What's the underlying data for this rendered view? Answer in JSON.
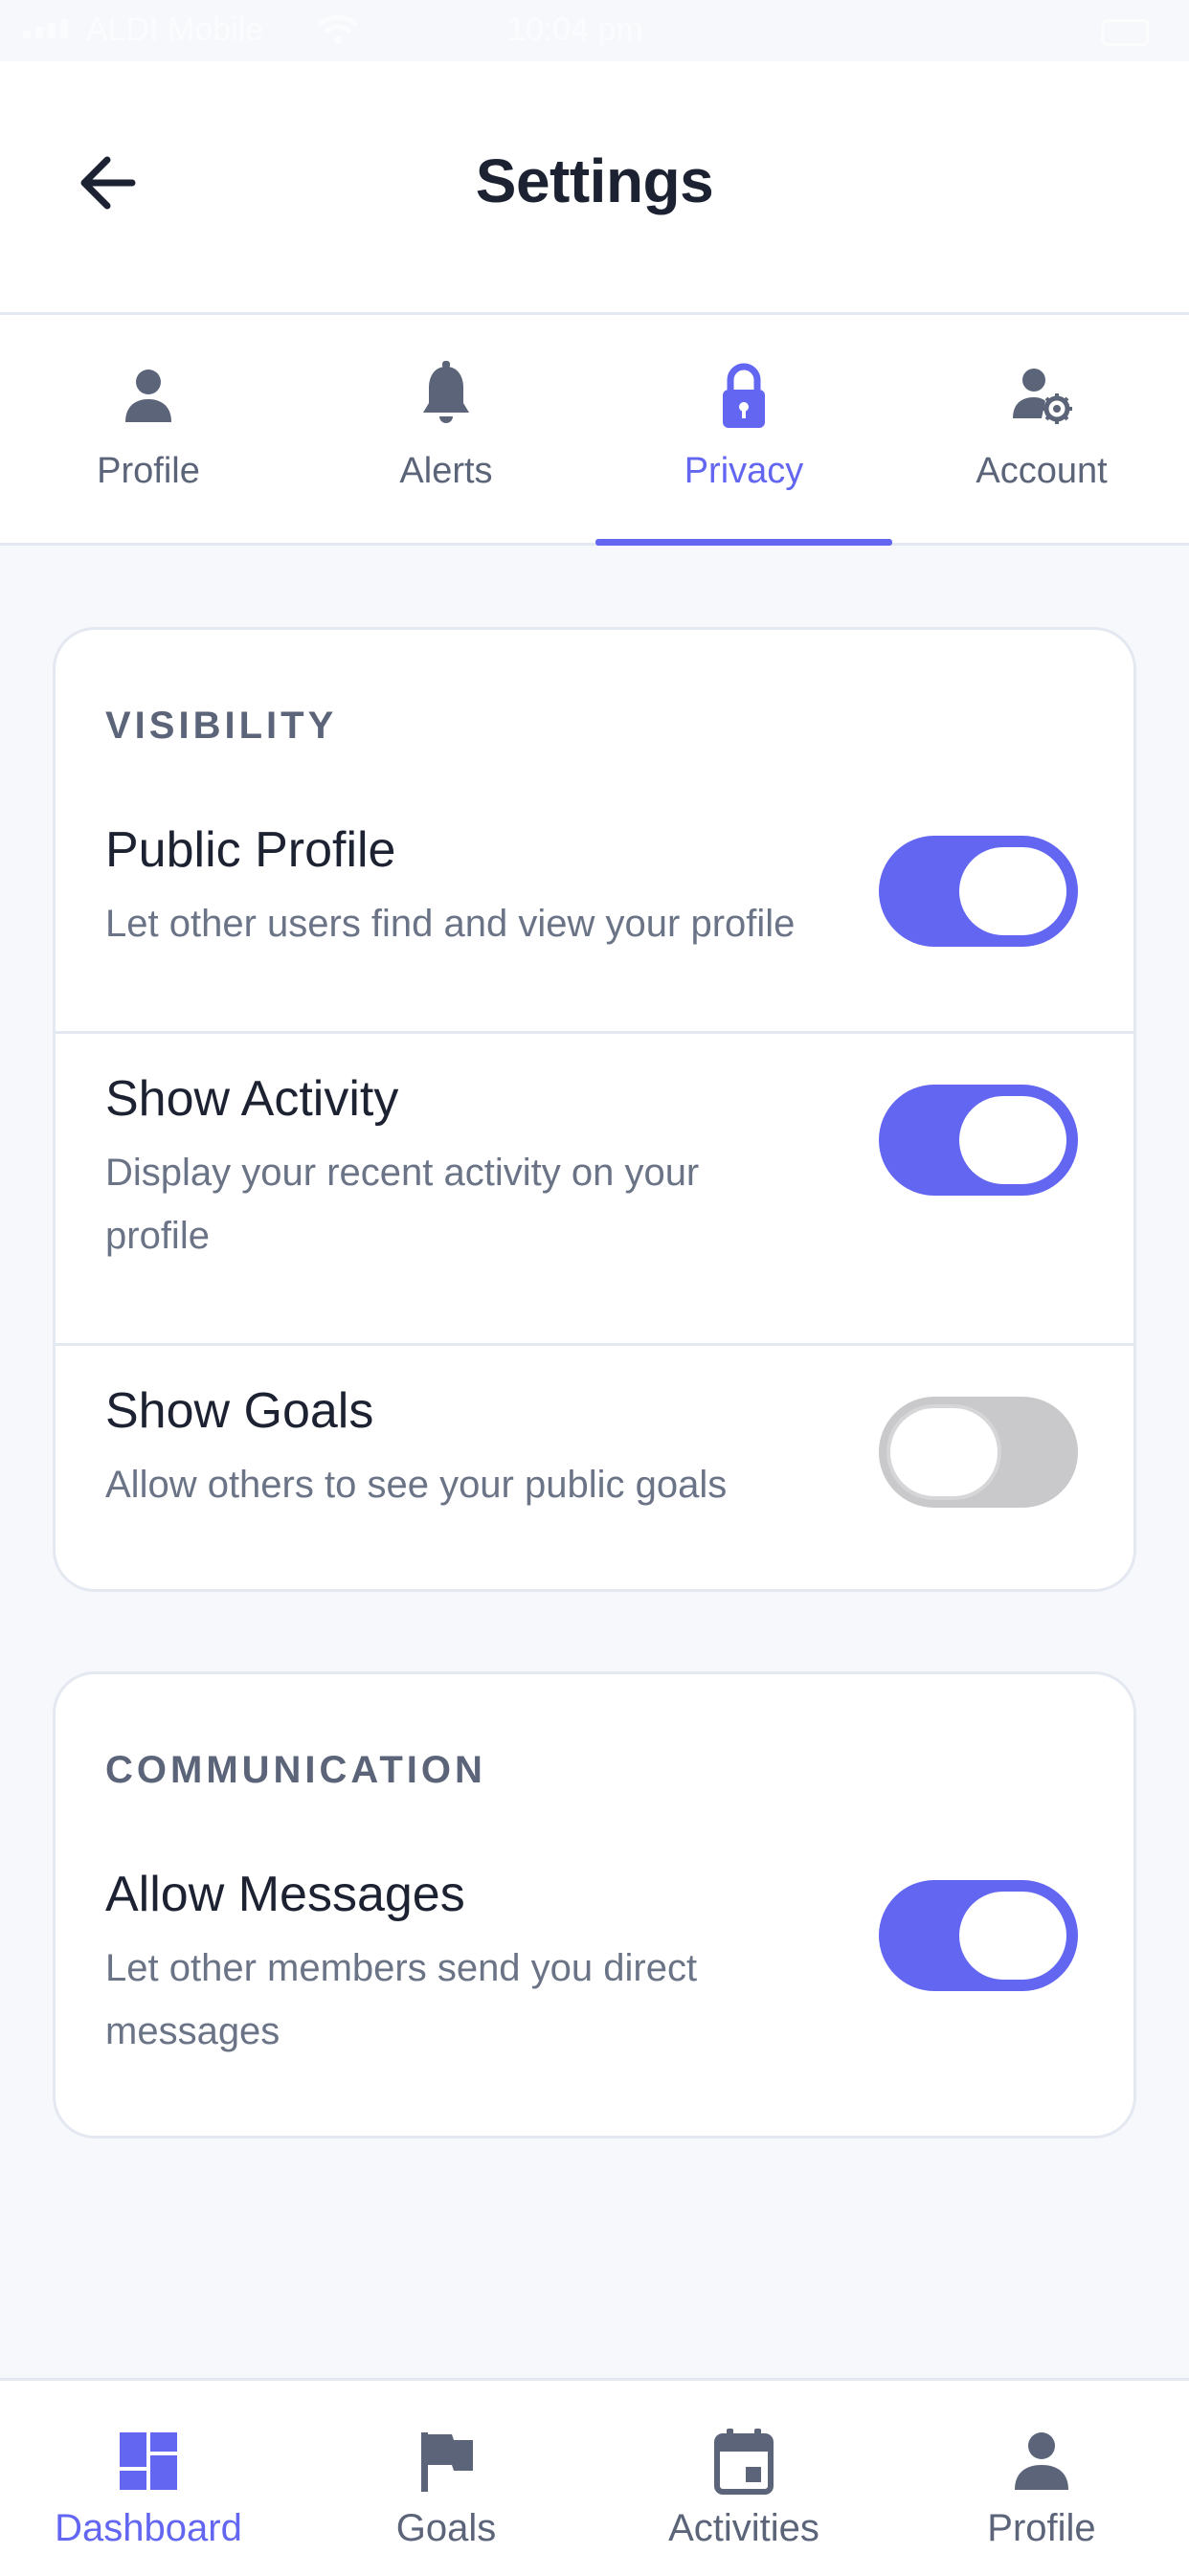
{
  "status_bar": {
    "carrier": "ALDI Mobile",
    "time": "10:04 pm"
  },
  "header": {
    "title": "Settings"
  },
  "tabs": [
    {
      "label": "Profile",
      "icon": "person-icon",
      "active": false
    },
    {
      "label": "Alerts",
      "icon": "bell-icon",
      "active": false
    },
    {
      "label": "Privacy",
      "icon": "lock-icon",
      "active": true
    },
    {
      "label": "Account",
      "icon": "user-gear-icon",
      "active": false
    }
  ],
  "visibility": {
    "title": "VISIBILITY",
    "items": [
      {
        "title": "Public Profile",
        "description": "Let other users find and view your profile",
        "enabled": true
      },
      {
        "title": "Show Activity",
        "description": "Display your recent activity on your profile",
        "enabled": true
      },
      {
        "title": "Show Goals",
        "description": "Allow others to see your public goals",
        "enabled": false
      }
    ]
  },
  "communication": {
    "title": "COMMUNICATION",
    "items": [
      {
        "title": "Allow Messages",
        "description": "Let other members send you direct messages",
        "enabled": true
      }
    ]
  },
  "bottom_nav": [
    {
      "label": "Dashboard",
      "icon": "dashboard-icon",
      "active": true
    },
    {
      "label": "Goals",
      "icon": "flag-icon",
      "active": false
    },
    {
      "label": "Activities",
      "icon": "calendar-icon",
      "active": false
    },
    {
      "label": "Profile",
      "icon": "person-icon",
      "active": false
    }
  ],
  "colors": {
    "accent": "#6366f1",
    "text": "#1d2232",
    "muted": "#5b6478",
    "toggle_off": "#c9c9cc"
  }
}
